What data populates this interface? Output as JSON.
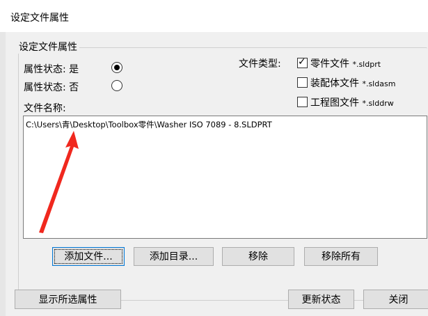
{
  "window": {
    "title": "设定文件属性"
  },
  "group": {
    "label": "设定文件属性"
  },
  "attribute": {
    "yes_label": "属性状态: 是",
    "no_label": "属性状态: 否",
    "selected": "是"
  },
  "file_type": {
    "label": "文件类型:",
    "options": [
      {
        "name": "零件文件",
        "ext": "*.sldprt",
        "checked": true
      },
      {
        "name": "装配体文件",
        "ext": "*.sldasm",
        "checked": false
      },
      {
        "name": "工程图文件",
        "ext": "*.slddrw",
        "checked": false
      }
    ]
  },
  "file_list": {
    "label": "文件名称:",
    "items": [
      "C:\\Users\\青\\Desktop\\Toolbox零件\\Washer ISO 7089 - 8.SLDPRT"
    ]
  },
  "buttons": {
    "add_file": "添加文件...",
    "add_dir": "添加目录...",
    "remove": "移除",
    "remove_all": "移除所有",
    "show_selected": "显示所选属性",
    "update_status": "更新状态",
    "close": "关闭"
  },
  "colors": {
    "annotation_arrow": "#f0281e",
    "dialog_bg": "#f0f0f0",
    "focus_border": "#0078d7"
  }
}
